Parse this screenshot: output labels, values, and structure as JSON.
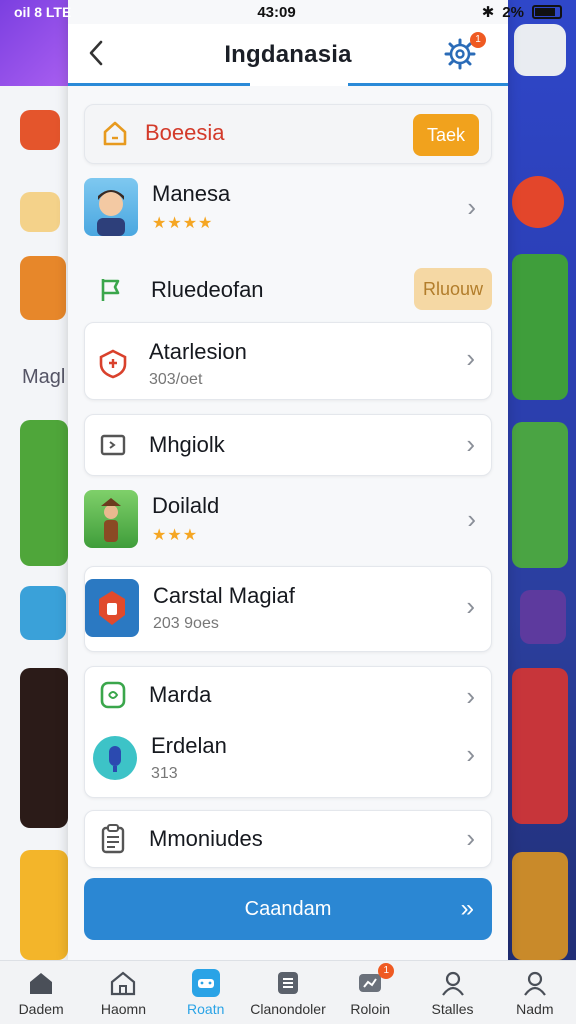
{
  "status": {
    "time": "43:09",
    "battery": "2%",
    "left": "oil 8 LTE"
  },
  "header": {
    "title": "Ingdanasia",
    "settings_badge": "1"
  },
  "background": {
    "left_label": "Magl"
  },
  "items": [
    {
      "title": "Boeesia",
      "pill": "Taek",
      "icon": "home-icon"
    },
    {
      "title": "Manesa",
      "stars": "★★★★",
      "icon": "avatar-app-icon"
    },
    {
      "title": "Rluedeofan",
      "pill": "Rluouw",
      "icon": "flag-icon"
    },
    {
      "title": "Atarlesion",
      "sub": "303/oet",
      "icon": "shield-icon"
    },
    {
      "title": "Mhgiolk",
      "icon": "box-icon"
    },
    {
      "title": "Doilald",
      "stars": "★★★",
      "icon": "game-app-icon"
    },
    {
      "title": "Carstal Magiaf",
      "sub": "203 9oes",
      "icon": "badge-app-icon"
    },
    {
      "title": "Marda",
      "icon": "cart-icon"
    },
    {
      "title": "Erdelan",
      "sub": "313",
      "icon": "mic-app-icon"
    },
    {
      "title": "Mmoniudes",
      "icon": "clipboard-icon"
    }
  ],
  "cta": {
    "label": "Caandam",
    "arrow": "»"
  },
  "nav": [
    {
      "label": "Dadem"
    },
    {
      "label": "Haomn"
    },
    {
      "label": "Roatn"
    },
    {
      "label": "Clanondoler"
    },
    {
      "label": "Roloin",
      "badge": "1"
    },
    {
      "label": "Stalles"
    },
    {
      "label": "Nadm"
    }
  ],
  "colors": {
    "accent": "#2b87d3",
    "orange": "#f1a21d",
    "red_badge": "#ef5a22"
  }
}
